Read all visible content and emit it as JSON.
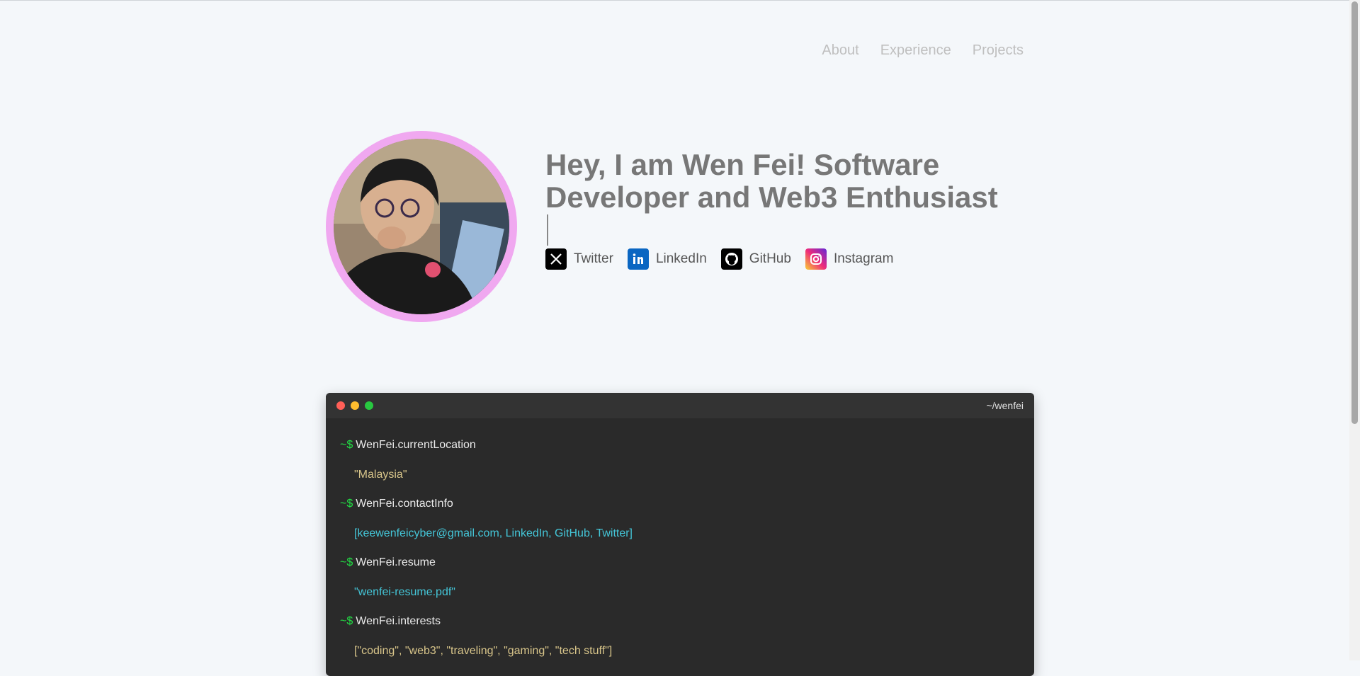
{
  "nav": {
    "items": [
      "About",
      "Experience",
      "Projects"
    ]
  },
  "hero": {
    "headline": "Hey, I am Wen Fei! Software Developer and Web3 Enthusiast",
    "avatar_ring_color": "#f0a8f0"
  },
  "socials": [
    {
      "label": "Twitter",
      "icon": "x-icon"
    },
    {
      "label": "LinkedIn",
      "icon": "linkedin-icon"
    },
    {
      "label": "GitHub",
      "icon": "github-icon"
    },
    {
      "label": "Instagram",
      "icon": "instagram-icon"
    }
  ],
  "terminal": {
    "title": "~/wenfei",
    "prompt": "~$",
    "entries": [
      {
        "command": "WenFei.currentLocation",
        "output": "\"Malaysia\""
      },
      {
        "command": "WenFei.contactInfo",
        "output": "[keewenfeicyber@gmail.com, LinkedIn, GitHub, Twitter]"
      },
      {
        "command": "WenFei.resume",
        "output": "\"wenfei-resume.pdf\""
      },
      {
        "command": "WenFei.interests",
        "output": "[\"coding\", \"web3\", \"traveling\", \"gaming\", \"tech stuff\"]"
      }
    ]
  },
  "colors": {
    "background": "#f4f7fa",
    "terminal_bg": "#2a2a2a",
    "prompt": "#22dd44",
    "string": "#d8c58a",
    "link": "#44c6d8"
  }
}
